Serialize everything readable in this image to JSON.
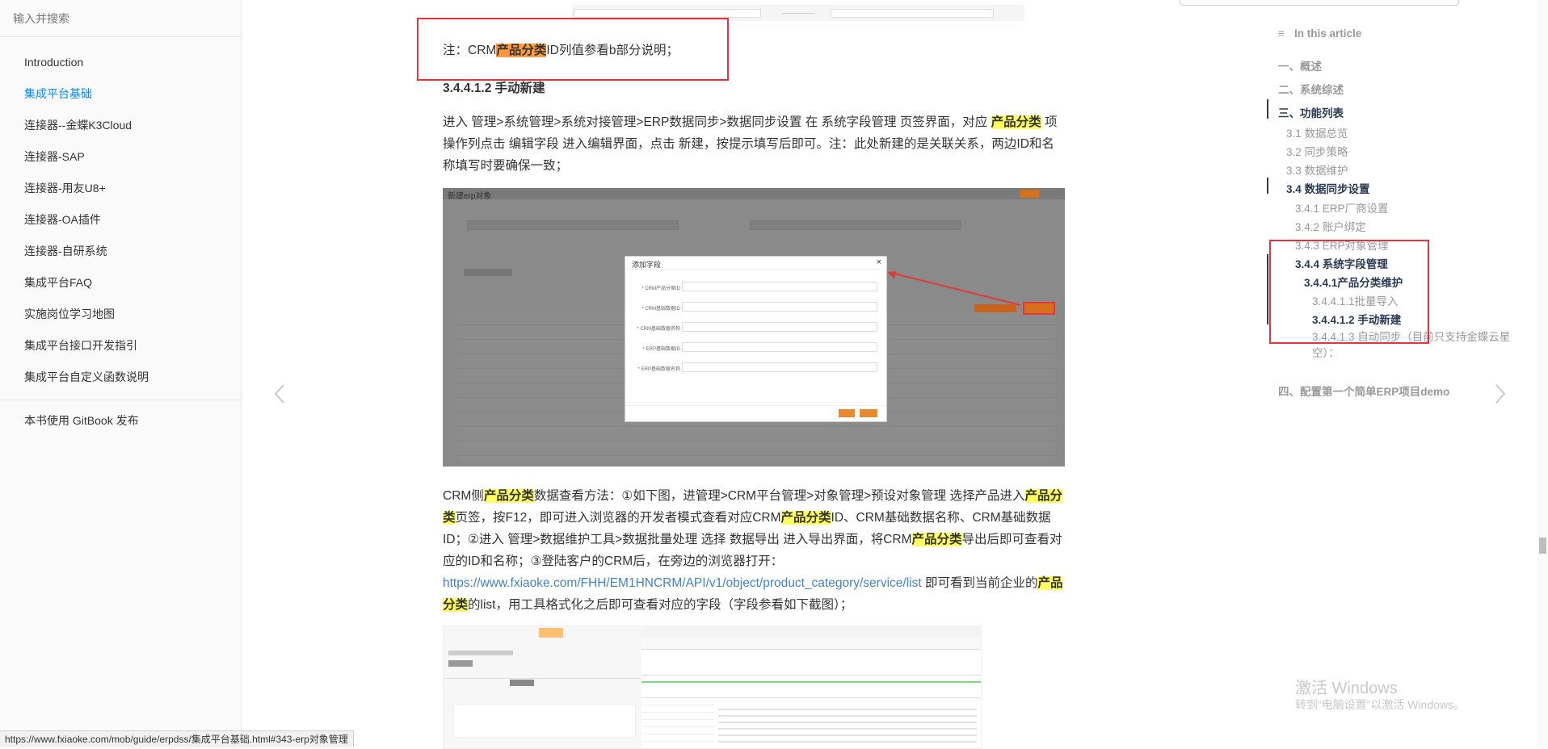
{
  "sidebar": {
    "search_placeholder": "输入并搜索",
    "items": [
      {
        "label": "Introduction"
      },
      {
        "label": "集成平台基础"
      },
      {
        "label": "连接器--金蝶K3Cloud"
      },
      {
        "label": "连接器-SAP"
      },
      {
        "label": "连接器-用友U8+"
      },
      {
        "label": "连接器-OA插件"
      },
      {
        "label": "连接器-自研系统"
      },
      {
        "label": "集成平台FAQ"
      },
      {
        "label": "实施岗位学习地图"
      },
      {
        "label": "集成平台接口开发指引"
      },
      {
        "label": "集成平台自定义函数说明"
      }
    ],
    "publish": "本书使用 GitBook 发布",
    "active_color": "#008cff"
  },
  "content": {
    "note_prefix": "注：CRM",
    "note_hl": "产品分类",
    "note_suffix": "ID列值参看b部分说明；",
    "heading": "3.4.4.1.2 手动新建",
    "p1_a": "进入 管理>系统管理>系统对接管理>ERP数据同步>数据同步设置 在 系统字段管理 页签界面，对应 ",
    "p1_hl": "产品分类",
    "p1_b": " 项操作列点击 编辑字段 进入编辑界面，点击 新建，按提示填写后即可。注：此处新建的是关联关系，两边ID和名称填写时要确保一致；",
    "p2_a": "CRM侧",
    "p2_hl1": "产品分类",
    "p2_b": "数据查看方法：①如下图，进管理>CRM平台管理>对象管理>预设对象管理 选择产品进入",
    "p2_hl2": "产品分类",
    "p2_c": "页签，按F12，即可进入浏览器的开发者模式查看对应CRM",
    "p2_hl3": "产品分类",
    "p2_d": "ID、CRM基础数据名称、CRM基础数据ID；②进入 管理>数据维护工具>数据批量处理 选择 数据导出 进入导出界面，将CRM",
    "p2_hl4": "产品分类",
    "p2_e": "导出后即可查看对应的ID和名称；③登陆客户的CRM后，在旁边的浏览器打开：",
    "p2_link": "https://www.fxiaoke.com/FHH/EM1HNCRM/API/v1/object/product_category/service/list",
    "p2_f": " 即可看到当前企业的",
    "p2_hl5": "产品分类",
    "p2_g": "的list，用工具格式化之后即可查看对应的字段（字段参看如下截图）；",
    "modal_title": "添加字段",
    "modal_fields": [
      "* CRM产品分类ID",
      "* CRM基础数据ID",
      "* CRM基础数据名称",
      "* ERP基础数据ID",
      "* ERP基础数据名称"
    ],
    "screenshot_title": "新建erp对象",
    "hl_color": "#ffff60",
    "hl_orange": "#ff9a3c",
    "box_color": "#e8323a"
  },
  "toc": {
    "title": "In this article",
    "items": [
      {
        "label": "一、概述"
      },
      {
        "label": "二、系统综述"
      },
      {
        "label": "三、功能列表"
      },
      {
        "label": "3.1 数据总览"
      },
      {
        "label": "3.2 同步策略"
      },
      {
        "label": "3.3 数据维护"
      },
      {
        "label": "3.4 数据同步设置"
      },
      {
        "label": "3.4.1 ERP厂商设置"
      },
      {
        "label": "3.4.2 账户绑定"
      },
      {
        "label": "3.4.3 ERP对象管理"
      },
      {
        "label": "3.4.4 系统字段管理"
      },
      {
        "label": "3.4.4.1产品分类维护"
      },
      {
        "label": "3.4.4.1.1批量导入"
      },
      {
        "label": "3.4.4.1.2 手动新建"
      },
      {
        "label": "3.4.4.1.3 自动同步（目前只支持金蝶云星空）："
      },
      {
        "label": "四、配置第一个简单ERP项目demo"
      }
    ]
  },
  "watermark": {
    "line1": "激活 Windows",
    "line2": "转到“电脑设置”以激活 Windows。"
  },
  "status_url": "https://www.fxiaoke.com/mob/guide/erpdss/集成平台基础.html#343-erp对象管理"
}
